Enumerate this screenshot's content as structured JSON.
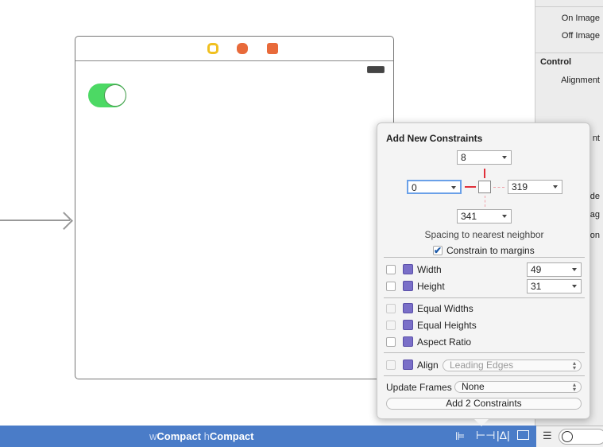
{
  "inspector": {
    "on_image": "On Image",
    "off_image": "Off Image",
    "section_control": "Control",
    "alignment": "Alignment",
    "partial_1": "nt",
    "partial_2": "de",
    "partial_3": "ag",
    "partial_4": "on"
  },
  "scene": {
    "dock_icons": [
      "view-controller-icon",
      "first-responder-icon",
      "exit-icon"
    ],
    "switch_on": true
  },
  "popover": {
    "title": "Add New Constraints",
    "top": "8",
    "leading": "0",
    "trailing": "319",
    "bottom": "341",
    "spacing_label": "Spacing to nearest neighbor",
    "constrain_margins_label": "Constrain to margins",
    "constrain_margins_checked": true,
    "width_label": "Width",
    "width_value": "49",
    "height_label": "Height",
    "height_value": "31",
    "equal_widths": "Equal Widths",
    "equal_heights": "Equal Heights",
    "aspect_ratio": "Aspect Ratio",
    "align_label": "Align",
    "align_value": "Leading Edges",
    "update_frames_label": "Update Frames",
    "update_frames_value": "None",
    "add_button": "Add 2 Constraints"
  },
  "bottombar": {
    "w_prefix": "w",
    "w_value": "Compact",
    "h_prefix": "h",
    "h_value": "Compact"
  },
  "colors": {
    "accent": "#4a7cc8",
    "constraint_red": "#e0303a",
    "switch_green": "#4cd964"
  }
}
